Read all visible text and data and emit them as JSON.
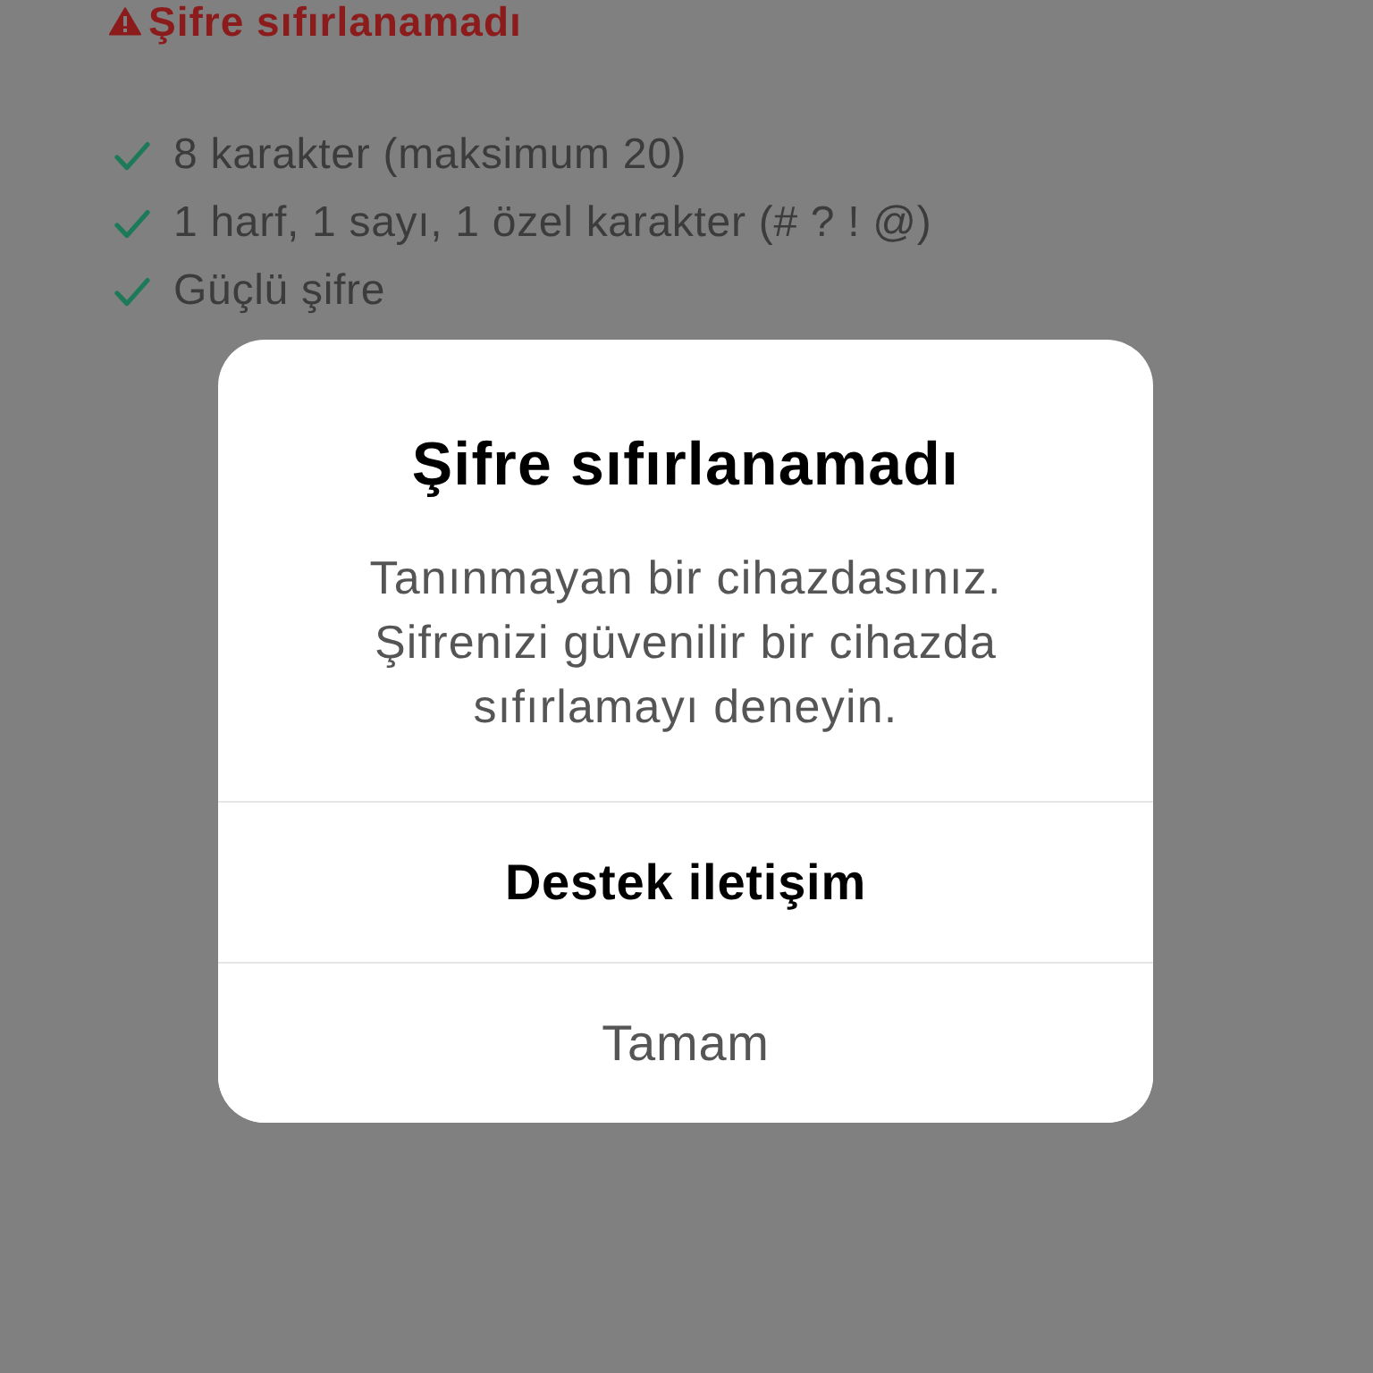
{
  "background_page": {
    "error": {
      "text": "Şifre sıfırlanamadı"
    },
    "requirements": [
      {
        "label": "8 karakter (maksimum 20)",
        "met": true
      },
      {
        "label": "1 harf, 1 sayı, 1 özel karakter (# ? ! @)",
        "met": true
      },
      {
        "label": "Güçlü şifre",
        "met": true
      }
    ]
  },
  "dialog": {
    "title": "Şifre sıfırlanamadı",
    "message": "Tanınmayan bir cihazdasınız. Şifrenizi güvenilir bir cihazda sıfırlamayı deneyin.",
    "buttons": [
      {
        "label": "Destek iletişim",
        "kind": "primary"
      },
      {
        "label": "Tamam",
        "kind": "default"
      }
    ]
  }
}
